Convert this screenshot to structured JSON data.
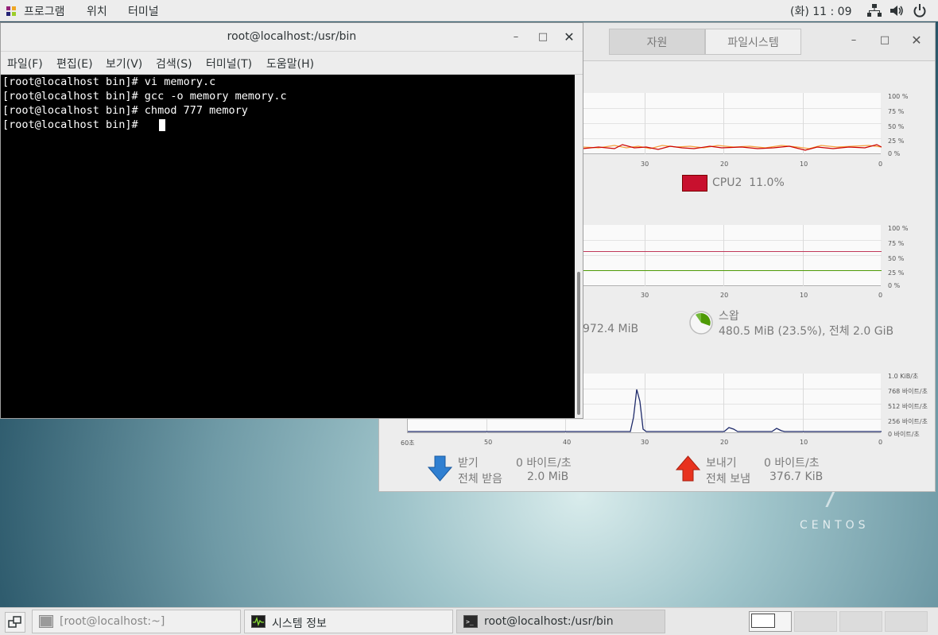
{
  "topbar": {
    "menu_programs": "프로그램",
    "menu_places": "위치",
    "menu_terminal": "터미널",
    "clock": "(화) 11 : 09",
    "icons": [
      "network-icon",
      "volume-icon",
      "power-icon"
    ]
  },
  "desktop": {
    "brand": "CENTOS"
  },
  "sysmon": {
    "tab_resources": "자원",
    "tab_filesystems": "파일시스템",
    "cpu_legend": "CPU2  11.0%",
    "cpu_legend_color": "#c8102e",
    "cpu_y_ticks": [
      "100 %",
      "75 %",
      "50 %",
      "25 %",
      "0 %"
    ],
    "cpu_x_ticks": [
      "30",
      "20",
      "10",
      "0"
    ],
    "mem_y_ticks": [
      "100 %",
      "75 %",
      "50 %",
      "25 %",
      "0 %"
    ],
    "mem_x_ticks": [
      "30",
      "20",
      "10",
      "0"
    ],
    "mem_partial": "972.4 MiB",
    "swap_label": "스왑",
    "swap_value": "480.5 MiB (23.5%), 전체 2.0 GiB",
    "swap_color": "#4e9a06",
    "net_y_ticks": [
      "1.0 KiB/초",
      "768 바이트/초",
      "512 바이트/초",
      "256 바이트/초",
      "0 바이트/초"
    ],
    "net_x_ticks": [
      "60초",
      "50",
      "40",
      "30",
      "20",
      "10",
      "0"
    ],
    "recv_label": "받기",
    "recv_rate": "0 바이트/초",
    "recv_total_label": "전체 받음",
    "recv_total": "2.0 MiB",
    "send_label": "보내기",
    "send_rate": "0 바이트/초",
    "send_total_label": "전체 보냄",
    "send_total": "376.7 KiB"
  },
  "terminal": {
    "title": "root@localhost:/usr/bin",
    "menus": [
      "파일(F)",
      "편집(E)",
      "보기(V)",
      "검색(S)",
      "터미널(T)",
      "도움말(H)"
    ],
    "lines": [
      "[root@localhost bin]# vi memory.c",
      "[root@localhost bin]# gcc -o memory memory.c",
      "[root@localhost bin]# chmod 777 memory",
      "[root@localhost bin]# "
    ]
  },
  "taskbar": {
    "task1": "[root@localhost:~]",
    "task2": "시스템 정보",
    "task3": "root@localhost:/usr/bin"
  }
}
